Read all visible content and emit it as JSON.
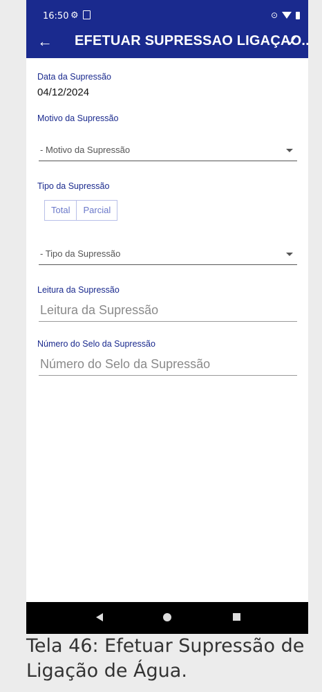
{
  "status_bar": {
    "time": "16:50",
    "gear_icon": "gear-icon",
    "location_icon": "location-icon"
  },
  "app_bar": {
    "title": "EFETUAR SUPRESSAO LIGAÇAO...",
    "back_icon": "arrow-left-icon",
    "confirm_icon": "check-icon",
    "color": "#1a2a8e"
  },
  "form": {
    "data_label": "Data da Supressão",
    "data_value": "04/12/2024",
    "motivo_label": "Motivo da Supressão",
    "motivo_select": "- Motivo da Supressão",
    "tipo_label": "Tipo da Supressão",
    "tipo_options": [
      "Total",
      "Parcial"
    ],
    "tipo_select": "- Tipo da Supressão",
    "leitura_label": "Leitura da Supressão",
    "leitura_placeholder": "Leitura da Supressão",
    "selo_label": "Número do Selo da Supressão",
    "selo_placeholder": "Número do Selo da Supressão"
  },
  "caption": "Tela 46: Efetuar Supressão de Ligação de Água."
}
